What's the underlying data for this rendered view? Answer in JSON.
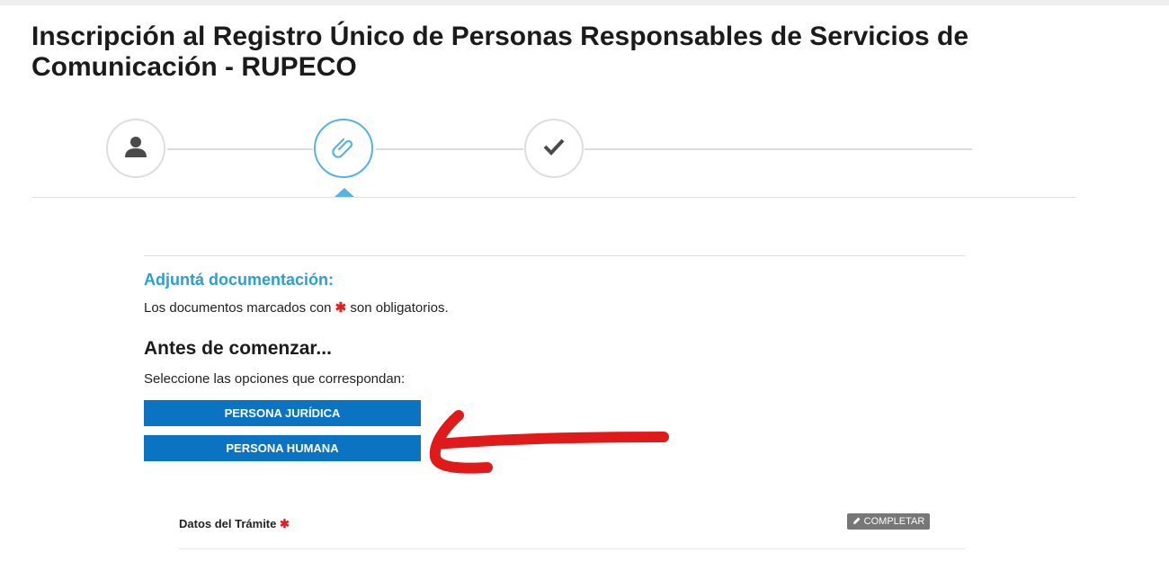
{
  "page": {
    "title": "Inscripción al Registro Único de Personas Responsables de Servicios de Comunicación - RUPECO"
  },
  "stepper": {
    "steps": [
      {
        "icon": "user-icon",
        "state": "completed"
      },
      {
        "icon": "paperclip-icon",
        "state": "active"
      },
      {
        "icon": "checkmark-icon",
        "state": "pending"
      }
    ]
  },
  "attach": {
    "heading": "Adjuntá documentación:",
    "note_before": "Los documentos marcados con",
    "note_mark": "✱",
    "note_after": "son obligatorios."
  },
  "antes": {
    "heading": "Antes de comenzar...",
    "prompt": "Seleccione las opciones que correspondan:",
    "options": [
      {
        "label": "PERSONA JURÍDICA"
      },
      {
        "label": "PERSONA HUMANA"
      }
    ]
  },
  "documents": [
    {
      "label": "Datos del Trámite",
      "required_mark": "✱",
      "action_label": "COMPLETAR"
    }
  ],
  "colors": {
    "accent_blue": "#2a9fd6",
    "button_blue": "#0a74c2",
    "required_red": "#e41d1d",
    "annotation_red": "#e01a1a",
    "action_gray": "#777777"
  }
}
